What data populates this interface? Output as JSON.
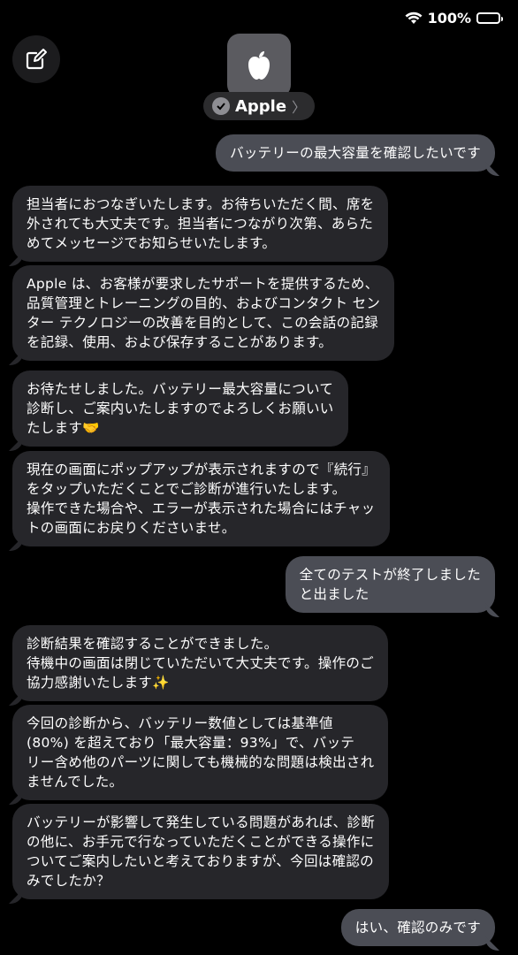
{
  "status_bar": {
    "battery": "100%"
  },
  "contact": {
    "name": "Apple",
    "chevron": "〉"
  },
  "icons": [
    "edit-icon",
    "wifi-icon",
    "battery-icon",
    "apple-logo-icon",
    "verified-icon"
  ],
  "colors": {
    "incoming": "#26262a",
    "outgoing": "#4b4d55",
    "background": "#000000"
  },
  "messages": [
    {
      "side": "out",
      "text": "バッテリーの最大容量を確認したいです"
    },
    {
      "side": "in",
      "text": "担当者におつなぎいたします。お待ちいただく間、席を\n外されても大丈夫です。担当者につながり次第、あらた\nめてメッセージでお知らせいたします。"
    },
    {
      "side": "in",
      "text": "Apple は、お客様が要求したサポートを提供するため、\n品質管理とトレーニングの目的、およびコンタクト セン\nター テクノロジーの改善を目的として、この会話の記録\nを記録、使用、および保存することがあります。"
    },
    {
      "side": "in",
      "text": "お待たせしました。バッテリー最大容量について\n診断し、ご案内いたしますのでよろしくお願いい\nたします🤝"
    },
    {
      "side": "in",
      "text": "現在の画面にポップアップが表示されますので『続行』\nをタップいただくことでご診断が進行いたします。\n操作できた場合や、エラーが表示された場合にはチャッ\nトの画面にお戻りくださいませ。"
    },
    {
      "side": "out",
      "text": "全てのテストが終了しました\nと出ました"
    },
    {
      "side": "in",
      "text": "診断結果を確認することができました。\n待機中の画面は閉じていただいて大丈夫です。操作のご\n協力感謝いたします✨"
    },
    {
      "side": "in",
      "text": "今回の診断から、バッテリー数値としては基準値\n(80%) を超えており「最大容量：93%」で、バッテ\nリー含め他のパーツに関しても機械的な問題は検出され\nませんでした。"
    },
    {
      "side": "in",
      "text": "バッテリーが影響して発生している問題があれば、診断\nの他に、お手元で行なっていただくことができる操作に\nついてご案内したいと考えておりますが、今回は確認の\nみでしたか？"
    },
    {
      "side": "out",
      "text": "はい、確認のみです"
    }
  ]
}
